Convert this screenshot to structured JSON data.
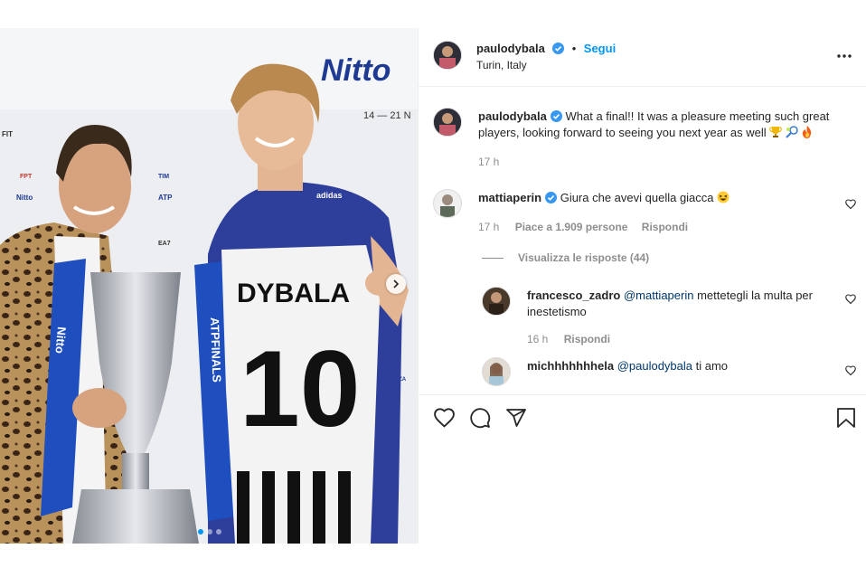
{
  "header": {
    "username": "paulodybala",
    "dot": "•",
    "follow_label": "Segui",
    "location": "Turin, Italy",
    "more_icon": "more-horizontal-icon"
  },
  "caption": {
    "username": "paulodybala",
    "text": "What a final!! It was a pleasure meeting such great players, looking forward to seeing you next year as well",
    "emojis": [
      "trophy",
      "tennis",
      "fire"
    ],
    "time": "17 h"
  },
  "comments": [
    {
      "username": "mattiaperin",
      "verified": true,
      "text": "Giura che avevi quella giacca",
      "emoji": "grinning-squint",
      "time": "17 h",
      "likes": "Piace a 1.909 persone",
      "reply_label": "Rispondi",
      "view_replies": "Visualizza le risposte (44)"
    },
    {
      "username": "francesco_zadro",
      "mention": "@mattiaperin",
      "text": "mettetegli la multa per inestetismo",
      "time": "16 h",
      "reply_label": "Rispondi"
    },
    {
      "username": "michhhhhhhela",
      "mention": "@paulodybala",
      "text": "ti amo"
    }
  ],
  "photo": {
    "brand": "Nitto",
    "dates": "14 — 21 N",
    "jersey_name": "DYBALA",
    "jersey_number": "10",
    "banner_top": "Nitto",
    "banner_bottom": "ATPFINALS",
    "sponsors": [
      "FIT",
      "FPT",
      "TIM",
      "Nitto",
      "ATP",
      "EA7",
      "LAVAZZA"
    ]
  },
  "colors": {
    "accent": "#0095f6",
    "verified": "#3897f0",
    "text": "#262626",
    "muted": "#8e8e8e",
    "link": "#00376b"
  }
}
